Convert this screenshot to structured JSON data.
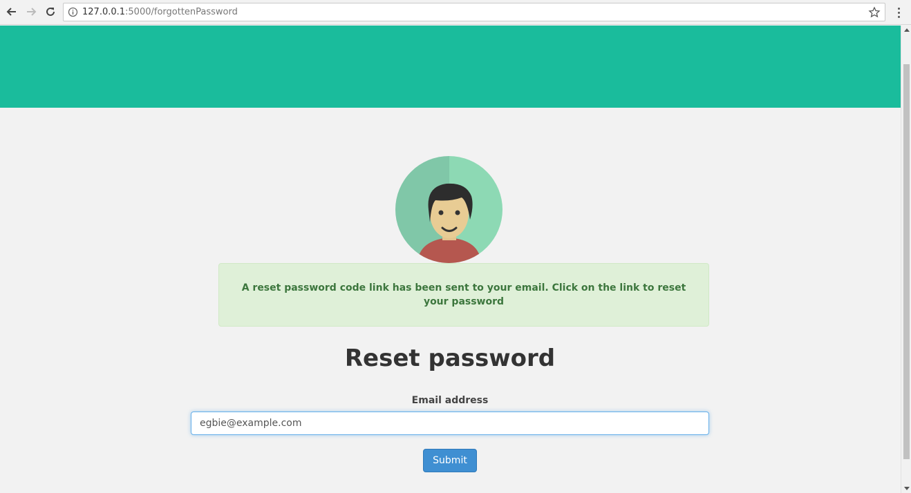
{
  "browser": {
    "url_host": "127.0.0.1",
    "url_path": ":5000/forgottenPassword"
  },
  "alert": {
    "message": "A reset password code link has been sent to your email. Click on the link to reset your password"
  },
  "page": {
    "title": "Reset password"
  },
  "form": {
    "email_label": "Email address",
    "email_value": "egbie@example.com",
    "submit_label": "Submit"
  },
  "colors": {
    "hero": "#1abc9c",
    "alert_bg": "#dff0d8",
    "alert_text": "#3c763d",
    "submit_bg": "#3f8fd2"
  },
  "icons": {
    "back": "arrow-left-icon",
    "forward": "arrow-right-icon",
    "reload": "reload-icon",
    "info": "info-icon",
    "bookmark": "star-icon",
    "menu": "kebab-menu-icon",
    "avatar": "user-avatar-illustration"
  }
}
